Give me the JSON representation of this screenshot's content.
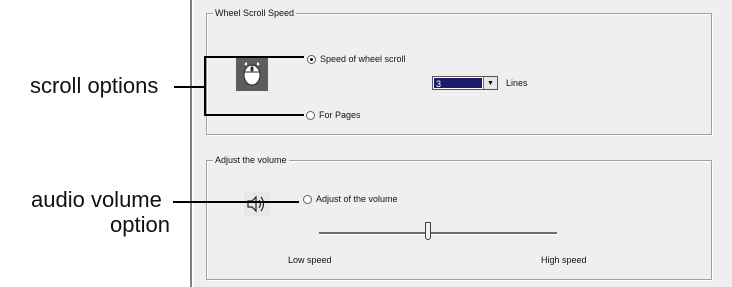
{
  "callouts": {
    "scroll_options": "scroll options",
    "audio_volume_line1": "audio volume",
    "audio_volume_line2": "option"
  },
  "wheel_group": {
    "title": "Wheel Scroll Speed",
    "option_speed_label": "Speed of wheel scroll",
    "option_speed_checked": true,
    "lines_value": "3",
    "lines_label": "Lines",
    "option_pages_label": "For Pages",
    "option_pages_checked": false
  },
  "volume_group": {
    "title": "Adjust the volume",
    "option_label": "Adjust of the volume",
    "option_checked": false,
    "slider_low_label": "Low speed",
    "slider_high_label": "High speed",
    "slider_position": 0.46
  },
  "icons": {
    "mouse": "mouse-wheel-icon",
    "volume": "speaker-volume-icon"
  }
}
